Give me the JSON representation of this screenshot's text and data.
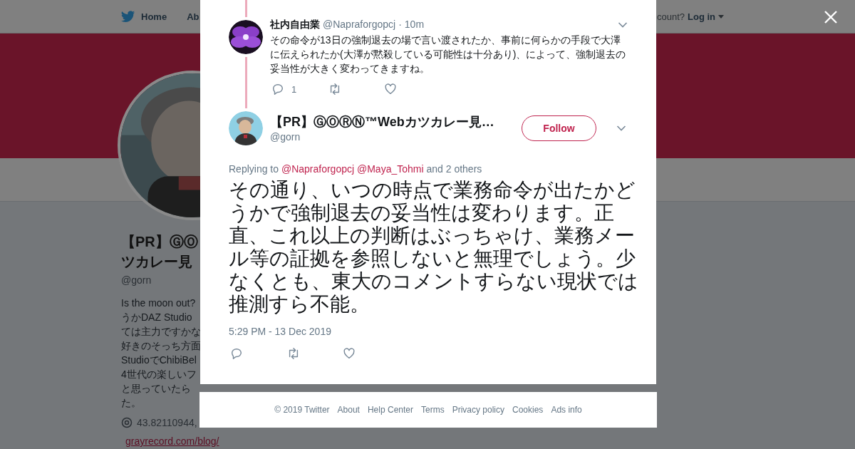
{
  "nav": {
    "home": "Home",
    "about": "Ab",
    "account_prompt": "count?",
    "login": "Log in"
  },
  "profile": {
    "name_lines": [
      "【PR】ⒼⓄ",
      "ツカレー見"
    ],
    "handle": "@gorn",
    "bio_lines": [
      "Is the moon out?",
      "うかDAZ Studio",
      "ては主力ですかな",
      "好きのそっち方面",
      "StudioでChibiBel",
      "4世代の楽しいフ",
      "と思っていたら",
      "た。"
    ],
    "location": "43.82110944,",
    "link": "grayrecord.com/blog/"
  },
  "thread": [
    {
      "name": "社内自由業",
      "handle": "@Napraforgopcj",
      "separator": "·",
      "time": "10m",
      "text": "その命令が13日の強制退去の場で言い渡されたか、事前に何らかの手段で大澤に伝えられたか(大澤が黙殺している可能性は十分あり)、によって、強制退去の妥当性が大きく変わってきますね。",
      "reply_count": "1"
    }
  ],
  "main_tweet": {
    "name": "【PR】ⒼⓄⓇⓃ™Webカツカレー見…",
    "handle": "@gorn",
    "follow": "Follow",
    "replying_label": "Replying to",
    "replying_to": [
      "@Napraforgopcj",
      "@Maya_Tohmi"
    ],
    "others": "and 2 others",
    "text": "その通り、いつの時点で業務命令が出たかどうかで強制退去の妥当性は変わります。正直、これ以上の判断はぶっちゃけ、業務メール等の証拠を参照しないと無理でしょう。少なくとも、東大のコメントすらない現状では推測すら不能。",
    "timestamp": "5:29 PM - 13 Dec 2019"
  },
  "footer": {
    "links": [
      "© 2019 Twitter",
      "About",
      "Help Center",
      "Terms",
      "Privacy policy",
      "Cookies",
      "Ads info"
    ]
  }
}
